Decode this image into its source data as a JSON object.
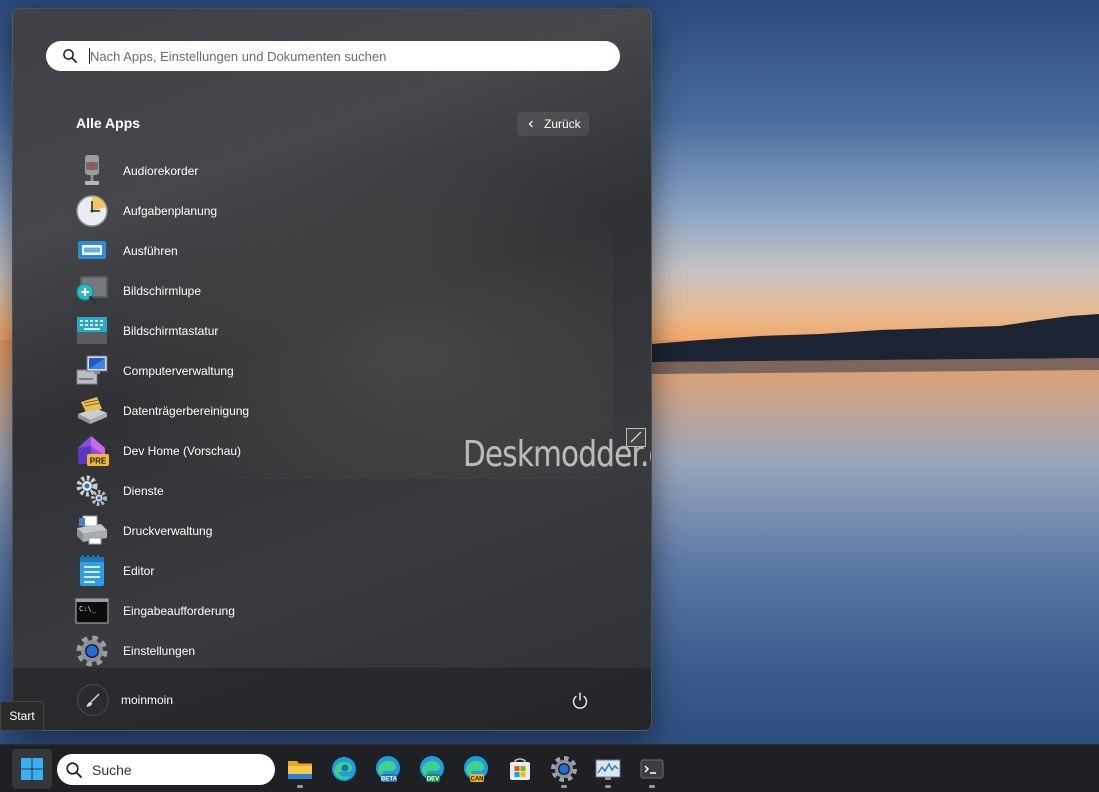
{
  "search": {
    "placeholder": "Nach Apps, Einstellungen und Dokumenten suchen"
  },
  "all_apps": {
    "title": "Alle Apps",
    "back_label": "Zurück"
  },
  "apps": [
    {
      "label": "Audiorekorder",
      "icon": "microphone-icon"
    },
    {
      "label": "Aufgabenplanung",
      "icon": "clock-icon"
    },
    {
      "label": "Ausführen",
      "icon": "run-icon"
    },
    {
      "label": "Bildschirmlupe",
      "icon": "magnifier-icon"
    },
    {
      "label": "Bildschirmtastatur",
      "icon": "keyboard-icon"
    },
    {
      "label": "Computerverwaltung",
      "icon": "computer-management-icon"
    },
    {
      "label": "Datenträgerbereinigung",
      "icon": "disk-cleanup-icon"
    },
    {
      "label": "Dev Home (Vorschau)",
      "icon": "dev-home-icon",
      "badge": "PRE"
    },
    {
      "label": "Dienste",
      "icon": "gears-icon"
    },
    {
      "label": "Druckverwaltung",
      "icon": "printer-icon"
    },
    {
      "label": "Editor",
      "icon": "notepad-icon"
    },
    {
      "label": "Eingabeaufforderung",
      "icon": "command-prompt-icon",
      "icon_text": "C:\\_"
    },
    {
      "label": "Einstellungen",
      "icon": "settings-gear-icon"
    }
  ],
  "footer": {
    "username": "moinmoin"
  },
  "watermark": "Deskmodder.de",
  "tooltip": "Start",
  "taskbar": {
    "search_label": "Suche",
    "apps": [
      {
        "name": "file-explorer",
        "color": "#f5c13b"
      },
      {
        "name": "edge",
        "color": "#1f9be0"
      },
      {
        "name": "edge-beta",
        "badge": "BETA",
        "color": "#1f9be0"
      },
      {
        "name": "edge-dev",
        "badge": "DEV",
        "color": "#1f9be0"
      },
      {
        "name": "edge-canary",
        "badge": "CAN",
        "color": "#1f9be0"
      },
      {
        "name": "microsoft-store",
        "color": "#3aa0e8"
      },
      {
        "name": "settings",
        "color": "#9aa0a6"
      },
      {
        "name": "resource-monitor",
        "color": "#58a6d6"
      },
      {
        "name": "terminal",
        "color": "#3b3b3b"
      }
    ]
  },
  "colors": {
    "accent": "#0078d4",
    "menu_bg": "#3a3b3f",
    "taskbar_bg": "#1f2023"
  }
}
